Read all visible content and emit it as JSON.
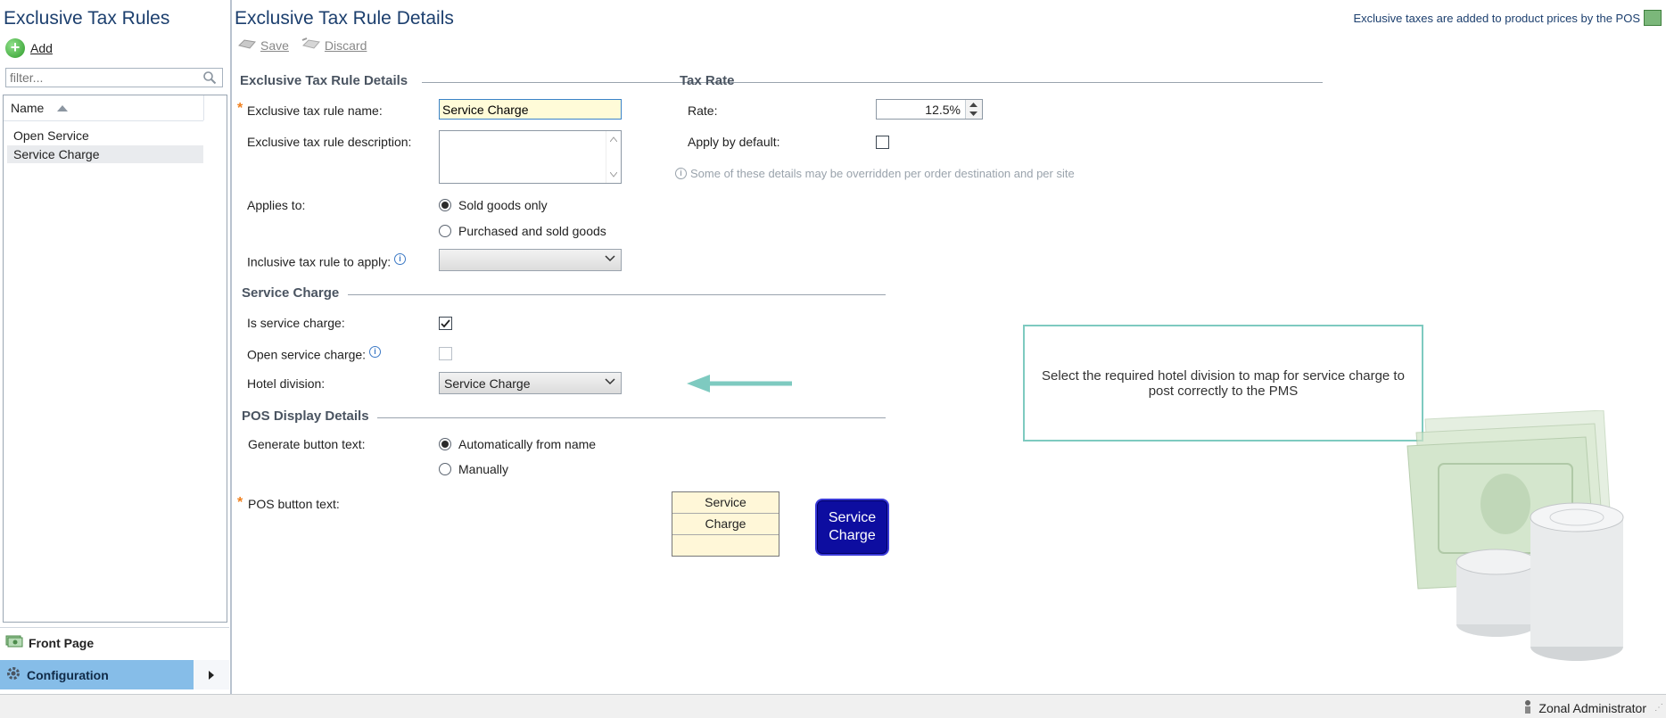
{
  "left_panel": {
    "title": "Exclusive Tax Rules",
    "add_label": "Add",
    "filter_placeholder": "filter...",
    "column_header": "Name",
    "rows": [
      "Open Service",
      "Service Charge"
    ],
    "selected_row": "Service Charge"
  },
  "nav": {
    "front_page": "Front Page",
    "configuration": "Configuration"
  },
  "main": {
    "title": "Exclusive Tax Rule Details",
    "header_note": "Exclusive taxes are added to product prices by the POS",
    "toolbar": {
      "save": "Save",
      "discard": "Discard"
    }
  },
  "details": {
    "section_title": "Exclusive Tax Rule Details",
    "name_label": "Exclusive tax rule name:",
    "name_value": "Service Charge",
    "description_label": "Exclusive tax rule description:",
    "description_value": "",
    "applies_to_label": "Applies to:",
    "applies_options": [
      "Sold goods only",
      "Purchased and sold goods"
    ],
    "applies_selected": "Sold goods only",
    "inclusive_label": "Inclusive tax rule to apply:",
    "inclusive_value": ""
  },
  "service_charge": {
    "section_title": "Service Charge",
    "is_service_label": "Is service charge:",
    "is_service_checked": true,
    "open_service_label": "Open service charge:",
    "open_service_checked": false,
    "hotel_division_label": "Hotel division:",
    "hotel_division_value": "Service Charge"
  },
  "pos_display": {
    "section_title": "POS Display Details",
    "generate_label": "Generate button text:",
    "generate_options": [
      "Automatically from name",
      "Manually"
    ],
    "generate_selected": "Automatically from name",
    "button_text_label": "POS button text:",
    "button_text_lines": [
      "Service",
      "Charge",
      ""
    ],
    "preview_lines": [
      "Service",
      "Charge"
    ]
  },
  "tax_rate": {
    "section_title": "Tax Rate",
    "rate_label": "Rate:",
    "rate_value": "12.5%",
    "apply_default_label": "Apply by default:",
    "apply_default_checked": false,
    "note": "Some of these details may be overridden per order destination and per site"
  },
  "callout": {
    "text": "Select the required hotel division to map for service charge to post correctly to the PMS"
  },
  "status_bar": {
    "user": "Zonal Administrator"
  },
  "colors": {
    "title_blue": "#1c3f6e",
    "nav_selected": "#86bde8",
    "callout_border": "#7ecac0",
    "arrow": "#7ecac0",
    "pos_button": "#0d0da0",
    "required": "#f07f1c"
  }
}
